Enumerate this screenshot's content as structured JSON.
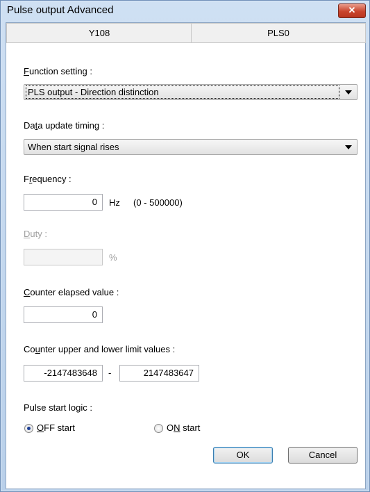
{
  "window": {
    "title": "Pulse output Advanced",
    "close_glyph": "✕"
  },
  "tabs": [
    {
      "label": "Y108"
    },
    {
      "label": "PLS0"
    }
  ],
  "function_setting": {
    "label_u": "F",
    "label_rest": "unction setting :",
    "value": "PLS output - Direction distinction"
  },
  "data_update_timing": {
    "label_pre": "Da",
    "label_u": "t",
    "label_rest": "a update timing :",
    "value": "When start signal rises"
  },
  "frequency": {
    "label_pre": "F",
    "label_u": "r",
    "label_rest": "equency :",
    "value": "0",
    "unit": "Hz",
    "range": "(0 - 500000)"
  },
  "duty": {
    "label_u": "D",
    "label_rest": "uty :",
    "value": "",
    "unit": "%"
  },
  "counter_elapsed": {
    "label_u": "C",
    "label_rest": "ounter elapsed value :",
    "value": "0"
  },
  "counter_limits": {
    "label_pre": "Co",
    "label_u": "u",
    "label_rest": "nter upper and lower limit values :",
    "lower": "-2147483648",
    "separator": "-",
    "upper": "2147483647"
  },
  "pulse_start_logic": {
    "label": "Pulse start logic :",
    "options": [
      {
        "label_u": "O",
        "label_rest": "FF start",
        "selected": true
      },
      {
        "label_pre": "O",
        "label_u": "N",
        "label_rest": " start",
        "selected": false
      }
    ]
  },
  "buttons": {
    "ok": "OK",
    "cancel": "Cancel"
  },
  "colors": {
    "title_bar": "#c3d7ee",
    "close_button": "#c9442d",
    "radio_selected": "#1c3f95"
  }
}
